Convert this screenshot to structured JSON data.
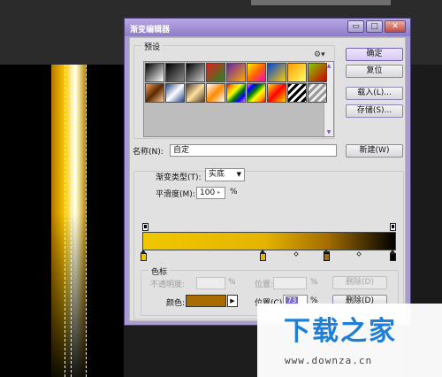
{
  "dialog": {
    "title": "渐变编辑器",
    "controls": {
      "minimize": "▭",
      "maximize": "□",
      "close": "✕"
    }
  },
  "presets": {
    "legend": "预设",
    "gear_icon": "gear-icon",
    "swatches": [
      "linear-gradient(135deg,#000,#fff)",
      "linear-gradient(135deg,#000,#888)",
      "linear-gradient(135deg,#000,#ccc)",
      "linear-gradient(135deg,#dd2222,#228822)",
      "linear-gradient(135deg,#6622aa,#ffaa00)",
      "linear-gradient(135deg,#ffee00,#ff6600,#ff00cc)",
      "linear-gradient(135deg,#0044dd,#ffcc00)",
      "linear-gradient(135deg,#ff9900,#ffff66)",
      "linear-gradient(135deg,#88cc00,#cc0000)",
      "linear-gradient(135deg,#ff9955,#5a2a00,#ffcc99)",
      "linear-gradient(135deg,#224488,#ffffff,#224488)",
      "linear-gradient(135deg,#4a3a2a,#ffe0a0,#4a3a2a)",
      "linear-gradient(135deg,#ffffff,#ff8800,#ffffff)",
      "linear-gradient(135deg,red,orange,yellow,green,blue,violet)",
      "linear-gradient(135deg,violet,blue,green,yellow,orange,red)",
      "linear-gradient(135deg,#ffdd00,#ff0000,#ffdd00)",
      "repeating-linear-gradient(135deg,#000 0 3px,#fff 3px 6px)",
      "repeating-linear-gradient(135deg,#999 0 3px,#eee 3px 6px)"
    ]
  },
  "buttons": {
    "ok": "确定",
    "reset": "复位",
    "load": "载入(L)...",
    "save": "存储(S)...",
    "new": "新建(W)",
    "delete_opacity": "删除(D)",
    "delete_color": "删除(D)"
  },
  "name": {
    "label": "名称(N):",
    "value": "自定"
  },
  "gradient": {
    "type_label": "渐变类型(T):",
    "type_value": "实底",
    "smoothness_label": "平滑度(M):",
    "smoothness_value": "100",
    "smoothness_unit": "%"
  },
  "color_stops": {
    "legend": "色标",
    "opacity_label": "不透明度:",
    "opacity_value": "",
    "opacity_unit": "%",
    "opacity_location_label": "位置:",
    "opacity_location_value": "",
    "opacity_location_unit": "%",
    "color_label": "颜色:",
    "color_value": "#a96c00",
    "location_label": "位置(C):",
    "location_value": "73",
    "location_unit": "%"
  },
  "watermark": {
    "logo": "下载之家",
    "url": "www.downza.cn"
  },
  "colors": {
    "dialog_frame": "#a99bd4",
    "gradient_start": "#f0c800",
    "gradient_end": "#000000",
    "stop_color": "#a96c00"
  }
}
